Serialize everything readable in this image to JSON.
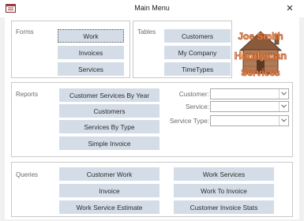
{
  "window": {
    "title": "Main Menu",
    "close_glyph": "✕"
  },
  "forms": {
    "label": "Forms",
    "buttons": [
      "Work",
      "Invoices",
      "Services"
    ]
  },
  "tables": {
    "label": "Tables",
    "buttons": [
      "Customers",
      "My Company",
      "TimeTypes"
    ]
  },
  "logo": {
    "line1": "Joe Smith",
    "line2": "Handyman",
    "line3": "Services",
    "text_color": "#e8924a"
  },
  "reports": {
    "label": "Reports",
    "buttons": [
      "Customer Services By Year",
      "Customers",
      "Services By Type",
      "Simple Invoice"
    ],
    "filters": [
      {
        "label": "Customer:",
        "value": ""
      },
      {
        "label": "Service:",
        "value": ""
      },
      {
        "label": "Service Type:",
        "value": ""
      }
    ]
  },
  "queries": {
    "label": "Queries",
    "left_buttons": [
      "Customer Work",
      "Invoice",
      "Work Service Estimate"
    ],
    "right_buttons": [
      "Work Services",
      "Work To Invoice",
      "Customer Invoice Stats"
    ]
  },
  "colors": {
    "button_bg": "#d4dde7",
    "label_gray": "#6b6b6b",
    "group_border": "#c9c9c9"
  }
}
